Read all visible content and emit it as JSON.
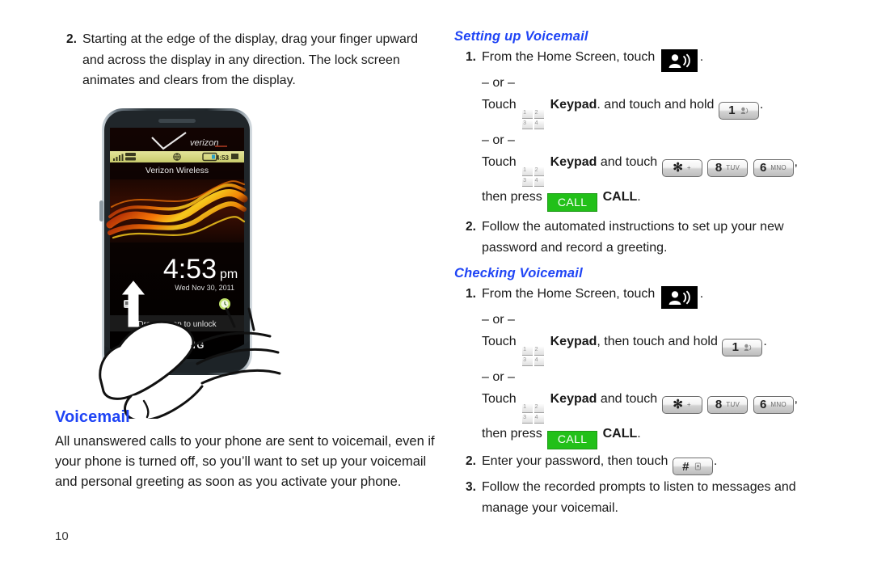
{
  "page": {
    "number": "10",
    "background": "#ffffff",
    "heading_color": "#1f44f5"
  },
  "left_column": {
    "step": {
      "num": "2.",
      "text": "Starting at the edge of the display, drag your finger upward and across the display in any direction. The lock screen animates and clears from the display."
    },
    "illustration": {
      "name": "phone-swipe-unlock-illustration",
      "carrier_logo": "verizon",
      "carrier_name": "Verizon Wireless",
      "status_bar_time": "4:53 pm",
      "clock_time": "4:53",
      "clock_meridiem": "pm",
      "clock_date": "Wed Nov 30, 2011",
      "unlock_hint": "Drag screen to unlock",
      "brand": "SAMSUNG",
      "statusbar_color": "#d9da86",
      "wallpaper_colors": [
        "#1a0603",
        "#d33208",
        "#ff8a00",
        "#ffe23a"
      ]
    },
    "section_heading": "Voicemail",
    "body_text": "All unanswered calls to your phone are sent to voicemail, even if your phone is turned off, so you’ll want to set up your voicemail and personal greeting as soon as you activate your phone."
  },
  "right_column": {
    "setting_up": {
      "heading": "Setting up Voicemail",
      "step1": {
        "num": "1.",
        "lead": "From the Home Screen, touch",
        "tail": ".",
        "or": "– or –",
        "alt1": {
          "touch": "Touch",
          "keypad_label": "Keypad",
          "mid": ". and touch and hold",
          "tail": "."
        },
        "or2": "– or –",
        "alt2": {
          "touch": "Touch",
          "keypad_label": "Keypad",
          "mid": "and touch",
          "comma": ",",
          "then_press": "then press",
          "call_bold": "CALL",
          "tail": "."
        }
      },
      "step2": {
        "num": "2.",
        "text": "Follow the automated instructions to set up your new password and record a greeting."
      }
    },
    "checking": {
      "heading": "Checking Voicemail",
      "step1": {
        "num": "1.",
        "lead": "From the Home Screen, touch",
        "tail": ".",
        "or": "– or –",
        "alt1": {
          "touch": "Touch",
          "keypad_label": "Keypad",
          "mid": ", then touch and hold",
          "tail": "."
        },
        "or2": "– or –",
        "alt2": {
          "touch": "Touch",
          "keypad_label": "Keypad",
          "mid": "and touch",
          "comma": ",",
          "then_press": "then press",
          "call_bold": "CALL",
          "tail": "."
        }
      },
      "step2": {
        "num": "2.",
        "lead": "Enter your password, then touch",
        "tail": "."
      },
      "step3": {
        "num": "3.",
        "text": "Follow the recorded prompts to listen to messages and manage your voicemail."
      }
    },
    "keys": {
      "one": {
        "digit": "1",
        "sub": ""
      },
      "star": {
        "digit": "✻",
        "sub": "+"
      },
      "eight": {
        "digit": "8",
        "sub": "TUV"
      },
      "six": {
        "digit": "6",
        "sub": "MNO"
      },
      "pound": {
        "digit": "#",
        "sub": ""
      },
      "call": {
        "label": "CALL",
        "color": "#22c019"
      }
    },
    "keypad_icon_digits": [
      "1",
      "2",
      "3",
      "4"
    ]
  }
}
